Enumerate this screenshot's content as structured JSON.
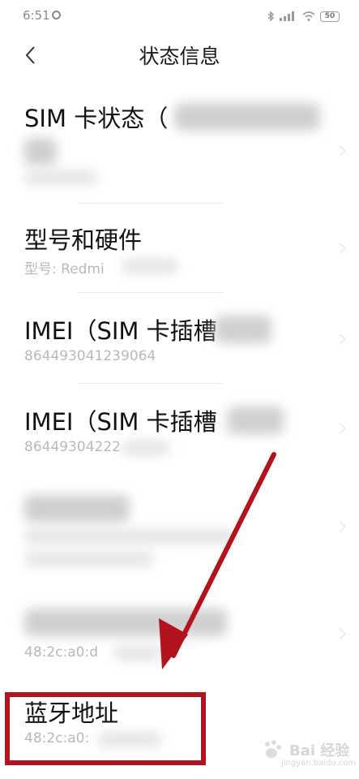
{
  "status_bar": {
    "time": "6:51",
    "battery": "50"
  },
  "header": {
    "title": "状态信息"
  },
  "rows": [
    {
      "title": "SIM 卡状态（",
      "subtitle": ""
    },
    {
      "title": "型号和硬件",
      "subtitle": "型号: Redmi"
    },
    {
      "title": "IMEI（SIM 卡插槽",
      "subtitle": "864493041239064"
    },
    {
      "title": "IMEI（SIM 卡插槽",
      "subtitle": "86449304222"
    },
    {
      "title": "",
      "subtitle": ""
    },
    {
      "title": "",
      "subtitle": "48:2c:a0:d"
    },
    {
      "title": "蓝牙地址",
      "subtitle": "48:2c:a0:"
    }
  ],
  "watermark": {
    "brand": "Bai 经验",
    "url": "jingyan.baidu.com"
  },
  "colors": {
    "highlight": "#b3131c",
    "arrow": "#b3131c"
  }
}
